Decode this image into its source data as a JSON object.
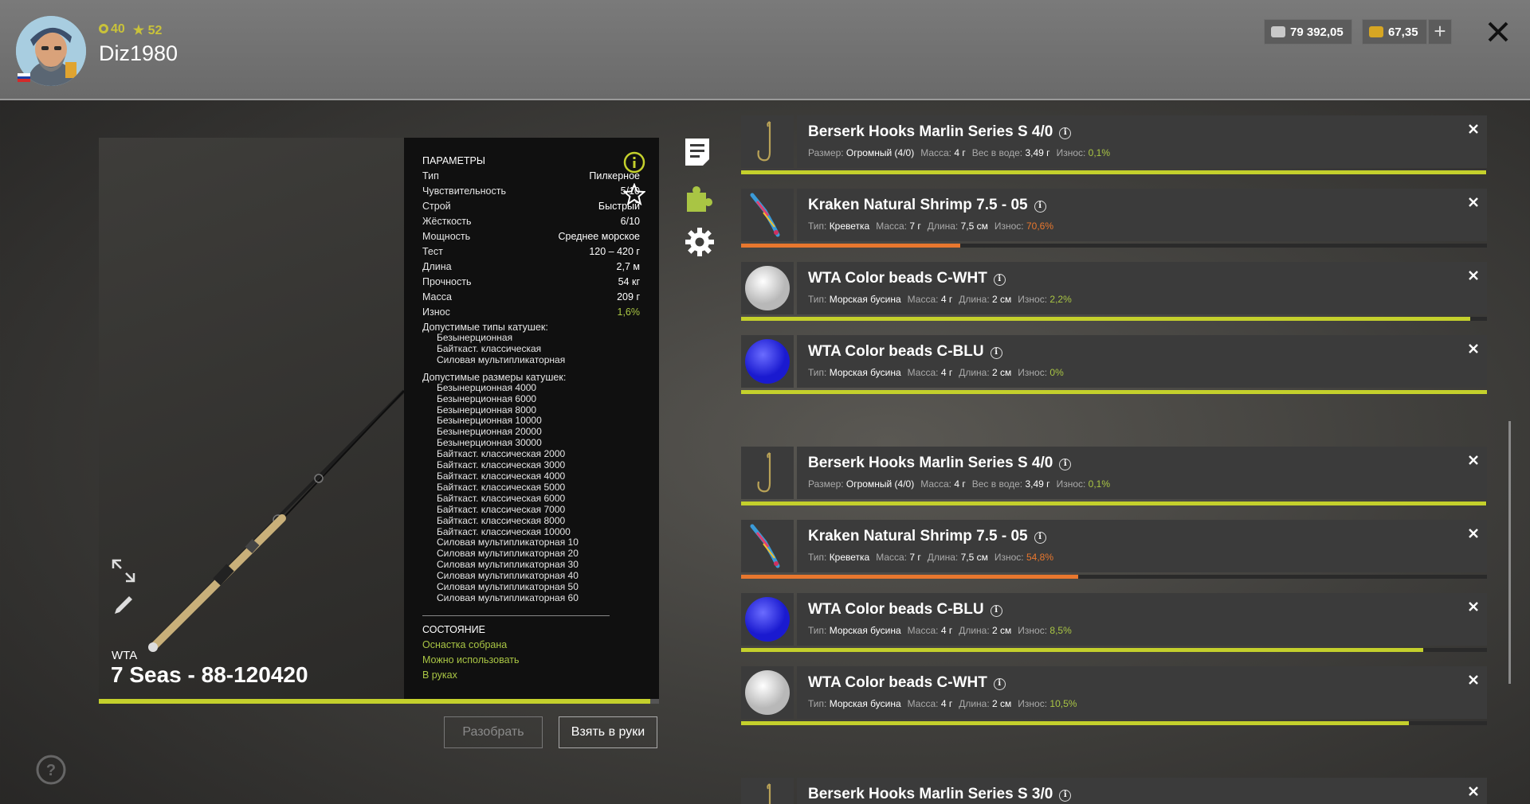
{
  "player": {
    "level": "40",
    "rank": "52",
    "username": "Diz1980",
    "flag_colors": [
      "#ffffff",
      "#1c3fa8",
      "#d42a2a"
    ]
  },
  "currency": {
    "silver": "79 392,05",
    "gold": "67,35"
  },
  "rod": {
    "brand": "WTA",
    "name": "7 Seas - 88-120420",
    "wear_fraction": 0.984
  },
  "params": {
    "title": "ПАРАМЕТРЫ",
    "rows": [
      {
        "label": "Тип",
        "value": "Пилкерное"
      },
      {
        "label": "Чувствительность",
        "value": "5/10"
      },
      {
        "label": "Строй",
        "value": "Быстрый"
      },
      {
        "label": "Жёсткость",
        "value": "6/10"
      },
      {
        "label": "Мощность",
        "value": "Среднее морское"
      },
      {
        "label": "Тест",
        "value": "120 – 420 г"
      },
      {
        "label": "Длина",
        "value": "2,7 м"
      },
      {
        "label": "Прочность",
        "value": "54 кг"
      },
      {
        "label": "Масса",
        "value": "209 г"
      },
      {
        "label": "Износ",
        "value": "1,6%"
      }
    ],
    "reel_types_title": "Допустимые типы катушек:",
    "reel_types": [
      "Безынерционная",
      "Байткаст. классическая",
      "Силовая мультипликаторная"
    ],
    "reel_sizes_title": "Допустимые размеры катушек:",
    "reel_sizes": [
      "Безынерционная 4000",
      "Безынерционная 6000",
      "Безынерционная 8000",
      "Безынерционная 10000",
      "Безынерционная 20000",
      "Безынерционная 30000",
      "Байткаст. классическая 2000",
      "Байткаст. классическая 3000",
      "Байткаст. классическая 4000",
      "Байткаст. классическая 5000",
      "Байткаст. классическая 6000",
      "Байткаст. классическая 7000",
      "Байткаст. классическая 8000",
      "Байткаст. классическая 10000",
      "Силовая мультипликаторная 10",
      "Силовая мультипликаторная 20",
      "Силовая мультипликаторная 30",
      "Силовая мультипликаторная 40",
      "Силовая мультипликаторная 50",
      "Силовая мультипликаторная 60"
    ],
    "state_title": "СОСТОЯНИЕ",
    "state_lines": [
      "Оснастка собрана",
      "Можно использовать",
      "В руках"
    ]
  },
  "buttons": {
    "disassemble": "Разобрать",
    "take": "Взять в руки"
  },
  "colors": {
    "accent_green": "#c4d02c",
    "wear_green": "#a9c544",
    "wear_orange": "#e8772e"
  },
  "tackle": [
    {
      "name": "Berserk Hooks Marlin Series S 4/0",
      "kind": "hook",
      "meta": [
        [
          "Размер:",
          "Огромный (4/0)"
        ],
        [
          "Масса:",
          "4 г"
        ],
        [
          "Вес в воде:",
          "3,49 г"
        ],
        [
          "Износ:",
          "0,1%"
        ]
      ],
      "wear_color": "#a9c544",
      "condition": 0.999,
      "bar_color": "#c4d02c"
    },
    {
      "name": "Kraken Natural Shrimp 7.5 - 05",
      "kind": "shrimp",
      "meta": [
        [
          "Тип:",
          "Креветка"
        ],
        [
          "Масса:",
          "7 г"
        ],
        [
          "Длина:",
          "7,5 см"
        ],
        [
          "Износ:",
          "70,6%"
        ]
      ],
      "wear_color": "#e8772e",
      "condition": 0.294,
      "bar_color": "#e8772e"
    },
    {
      "name": "WTA Color beads C-WHT",
      "kind": "bead-white",
      "meta": [
        [
          "Тип:",
          "Морская бусина"
        ],
        [
          "Масса:",
          "4 г"
        ],
        [
          "Длина:",
          "2 см"
        ],
        [
          "Износ:",
          "2,2%"
        ]
      ],
      "wear_color": "#a9c544",
      "condition": 0.978,
      "bar_color": "#c4d02c"
    },
    {
      "name": "WTA Color beads C-BLU",
      "kind": "bead-blue",
      "meta": [
        [
          "Тип:",
          "Морская бусина"
        ],
        [
          "Масса:",
          "4 г"
        ],
        [
          "Длина:",
          "2 см"
        ],
        [
          "Износ:",
          "0%"
        ]
      ],
      "wear_color": "#a9c544",
      "condition": 1.0,
      "bar_color": "#c4d02c"
    },
    {
      "name": "Berserk Hooks Marlin Series S 4/0",
      "kind": "hook",
      "meta": [
        [
          "Размер:",
          "Огромный (4/0)"
        ],
        [
          "Масса:",
          "4 г"
        ],
        [
          "Вес в воде:",
          "3,49 г"
        ],
        [
          "Износ:",
          "0,1%"
        ]
      ],
      "wear_color": "#a9c544",
      "condition": 0.999,
      "bar_color": "#c4d02c"
    },
    {
      "name": "Kraken Natural Shrimp 7.5 - 05",
      "kind": "shrimp",
      "meta": [
        [
          "Тип:",
          "Креветка"
        ],
        [
          "Масса:",
          "7 г"
        ],
        [
          "Длина:",
          "7,5 см"
        ],
        [
          "Износ:",
          "54,8%"
        ]
      ],
      "wear_color": "#e8772e",
      "condition": 0.452,
      "bar_color": "#e8772e"
    },
    {
      "name": "WTA Color beads C-BLU",
      "kind": "bead-blue",
      "meta": [
        [
          "Тип:",
          "Морская бусина"
        ],
        [
          "Масса:",
          "4 г"
        ],
        [
          "Длина:",
          "2 см"
        ],
        [
          "Износ:",
          "8,5%"
        ]
      ],
      "wear_color": "#a9c544",
      "condition": 0.915,
      "bar_color": "#c4d02c"
    },
    {
      "name": "WTA Color beads C-WHT",
      "kind": "bead-white",
      "meta": [
        [
          "Тип:",
          "Морская бусина"
        ],
        [
          "Масса:",
          "4 г"
        ],
        [
          "Длина:",
          "2 см"
        ],
        [
          "Износ:",
          "10,5%"
        ]
      ],
      "wear_color": "#a9c544",
      "condition": 0.895,
      "bar_color": "#c4d02c"
    },
    {
      "name": "Berserk Hooks Marlin Series S 3/0",
      "kind": "hook",
      "meta": [],
      "wear_color": "#a9c544",
      "condition": 1.0,
      "bar_color": "#c4d02c"
    }
  ]
}
